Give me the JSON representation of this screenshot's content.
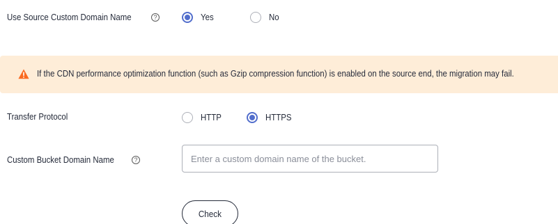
{
  "source_domain": {
    "label": "Use Source Custom Domain Name",
    "help_symbol": "?",
    "options": {
      "yes": "Yes",
      "no": "No"
    },
    "selected": "Yes"
  },
  "alert": {
    "icon": "warning-triangle-icon",
    "text": "If the CDN performance optimization function (such as Gzip compression function) is enabled on the source end, the migration may fail."
  },
  "transfer_protocol": {
    "label": "Transfer Protocol",
    "options": {
      "http": "HTTP",
      "https": "HTTPS"
    },
    "selected": "HTTPS"
  },
  "bucket_domain": {
    "label": "Custom Bucket Domain Name",
    "help_symbol": "?",
    "value": "",
    "placeholder": "Enter a custom domain name of the bucket."
  },
  "check_button": {
    "label": "Check"
  },
  "colors": {
    "accent": "#526ecc",
    "alert_background": "#feedd8",
    "warning_icon": "#fa6a1f",
    "text": "#252b3a",
    "placeholder": "#8a8e99",
    "border": "#adb0b8"
  }
}
